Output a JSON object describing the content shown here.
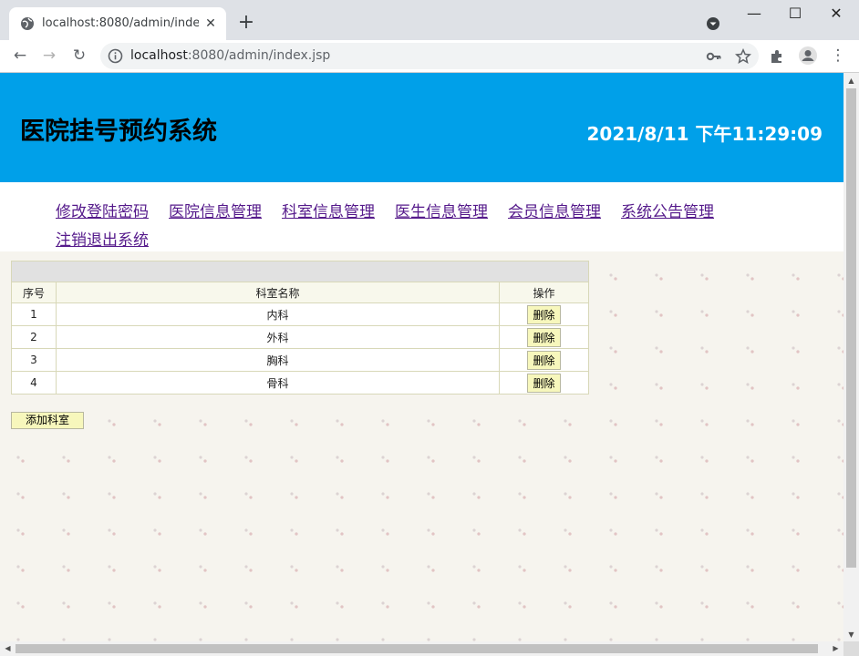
{
  "browser": {
    "tab_title": "localhost:8080/admin/index.jsp",
    "close_glyph": "✕",
    "new_tab_glyph": "+",
    "url_host": "localhost",
    "url_rest": ":8080/admin/index.jsp",
    "window_controls": {
      "minimize": "—",
      "maximize": "☐",
      "close": "✕"
    },
    "nav_glyphs": {
      "back": "←",
      "forward": "→",
      "reload": "↻",
      "menu": "⋮"
    }
  },
  "header": {
    "title": "医院挂号预约系统",
    "clock": "2021/8/11 下午11:29:09",
    "bg_color": "#00a0e9"
  },
  "nav": {
    "links": [
      {
        "label": "修改登陆密码"
      },
      {
        "label": "医院信息管理"
      },
      {
        "label": "科室信息管理"
      },
      {
        "label": "医生信息管理"
      },
      {
        "label": "会员信息管理"
      },
      {
        "label": "系统公告管理"
      },
      {
        "label": "注销退出系统"
      }
    ]
  },
  "table": {
    "headers": {
      "index": "序号",
      "name": "科室名称",
      "action": "操作"
    },
    "rows": [
      {
        "index": "1",
        "name": "内科",
        "action": "删除"
      },
      {
        "index": "2",
        "name": "外科",
        "action": "删除"
      },
      {
        "index": "3",
        "name": "胸科",
        "action": "删除"
      },
      {
        "index": "4",
        "name": "骨科",
        "action": "删除"
      }
    ]
  },
  "add_button": "添加科室",
  "scroll_glyphs": {
    "up": "▲",
    "down": "▼",
    "left": "◀",
    "right": "▶"
  }
}
